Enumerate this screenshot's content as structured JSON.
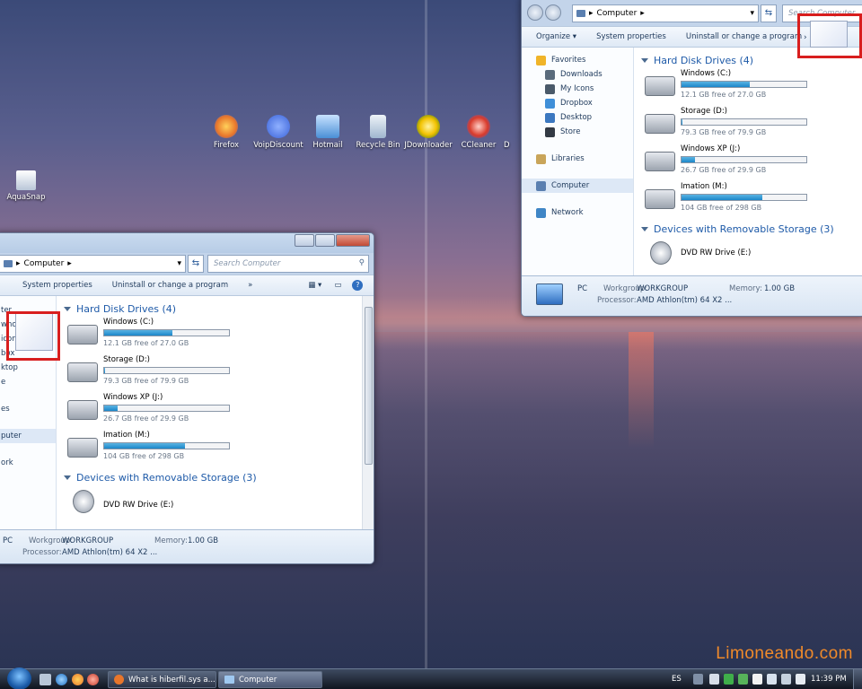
{
  "desktop": {
    "icons": [
      {
        "label": "Firefox",
        "color": "#e8762b"
      },
      {
        "label": "VoipDiscount",
        "color": "#3a62d8"
      },
      {
        "label": "Hotmail",
        "color": "#4a8fd6"
      },
      {
        "label": "Recycle Bin",
        "color": "#9fb6cf"
      },
      {
        "label": "JDownloader",
        "color": "#f2c200"
      },
      {
        "label": "CCleaner",
        "color": "#d93b2b"
      },
      {
        "label": "AquaSnap",
        "color": "#dfe6f0"
      }
    ],
    "partial_icon_label": "D"
  },
  "watermark": "Limoneando.com",
  "window_left": {
    "address_crumb": "Computer",
    "search_placeholder": "Search Computer",
    "cmdbar": [
      "System properties",
      "Uninstall or change a program",
      "»"
    ],
    "nav_partial": [
      "ter",
      "wno",
      "icon",
      "box",
      "ktop",
      "e",
      "es",
      "puter",
      "ork"
    ],
    "group_hdd": "Hard Disk Drives (4)",
    "drives": [
      {
        "name": "Windows (C:)",
        "free": "12.1 GB free of 27.0 GB",
        "used": 0.55
      },
      {
        "name": "Storage (D:)",
        "free": "79.3 GB free of 79.9 GB",
        "used": 0.01
      },
      {
        "name": "Windows XP (J:)",
        "free": "26.7 GB free of 29.9 GB",
        "used": 0.11
      },
      {
        "name": "Imation (M:)",
        "free": "104 GB free of 298 GB",
        "used": 0.65
      }
    ],
    "group_removable": "Devices with Removable Storage (3)",
    "dvd": "DVD RW Drive (E:)",
    "details": {
      "name": "PC",
      "workgroup_label": "Workgroup:",
      "workgroup": "WORKGROUP",
      "memory_label": "Memory:",
      "memory": "1.00 GB",
      "processor_label": "Processor:",
      "processor": "AMD Athlon(tm) 64 X2 ..."
    }
  },
  "window_right": {
    "address_crumb": "Computer",
    "search_placeholder": "Search Computer",
    "cmdbar": [
      "Organize",
      "System properties",
      "Uninstall or change a program"
    ],
    "nav": [
      {
        "label": "Favorites",
        "color": "#f0b429",
        "section": true
      },
      {
        "label": "Downloads",
        "color": "#5a6b7c"
      },
      {
        "label": "My Icons",
        "color": "#4a5a6a"
      },
      {
        "label": "Dropbox",
        "color": "#3f8fd8"
      },
      {
        "label": "Desktop",
        "color": "#3c78c0"
      },
      {
        "label": "Store",
        "color": "#333a44"
      },
      {
        "label": "Libraries",
        "color": "#c9a55a",
        "section": true
      },
      {
        "label": "Computer",
        "color": "#5a7fb0",
        "section": true,
        "selected": true
      },
      {
        "label": "Network",
        "color": "#3f86c6",
        "section": true
      }
    ],
    "group_hdd": "Hard Disk Drives (4)",
    "drives": [
      {
        "name": "Windows (C:)",
        "free": "12.1 GB free of 27.0 GB",
        "used": 0.55
      },
      {
        "name": "Storage (D:)",
        "free": "79.3 GB free of 79.9 GB",
        "used": 0.01
      },
      {
        "name": "Windows XP (J:)",
        "free": "26.7 GB free of 29.9 GB",
        "used": 0.11
      },
      {
        "name": "Imation (M:)",
        "free": "104 GB free of 298 GB",
        "used": 0.65
      }
    ],
    "group_removable": "Devices with Removable Storage (3)",
    "dvd": "DVD RW Drive (E:)",
    "details": {
      "name": "PC",
      "workgroup_label": "Workgroup:",
      "workgroup": "WORKGROUP",
      "memory_label": "Memory:",
      "memory": "1.00 GB",
      "processor_label": "Processor:",
      "processor": "AMD Athlon(tm) 64 X2 ..."
    }
  },
  "taskbar": {
    "tasks": [
      {
        "label": "What is hiberfil.sys a...",
        "color": "#e8762b"
      },
      {
        "label": "Computer",
        "color": "#5a7fb0"
      }
    ],
    "lang": "ES",
    "clock": "11:39 PM"
  }
}
